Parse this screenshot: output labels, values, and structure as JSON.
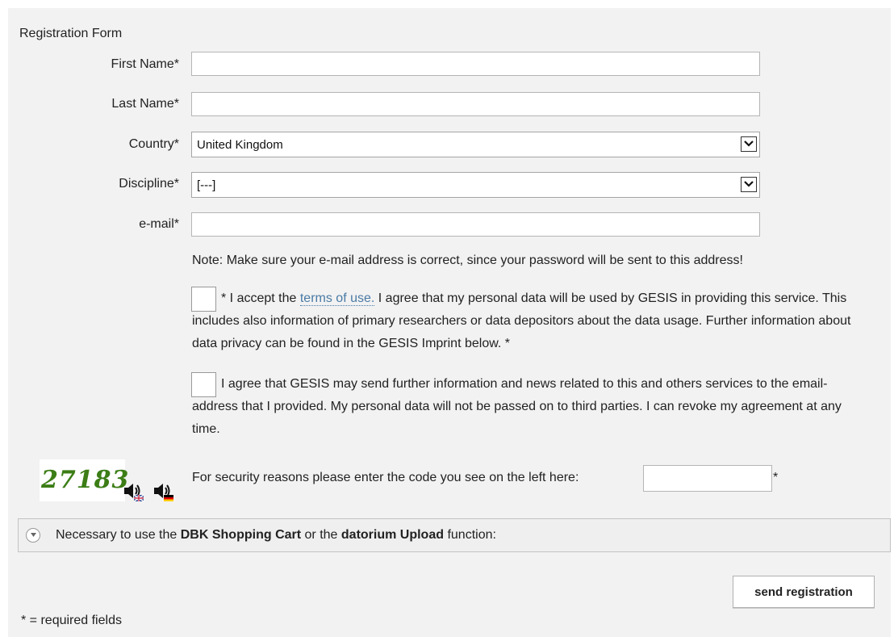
{
  "form": {
    "title": "Registration Form",
    "fields": {
      "first_name": {
        "label": "First Name*",
        "value": ""
      },
      "last_name": {
        "label": "Last Name*",
        "value": ""
      },
      "country": {
        "label": "Country*",
        "selected": "United Kingdom"
      },
      "discipline": {
        "label": "Discipline*",
        "selected": "[---]"
      },
      "email": {
        "label": "e-mail*",
        "value": ""
      }
    },
    "note": "Note: Make sure your e-mail address is correct, since your password will be sent to this address!",
    "terms": {
      "prefix": "* I accept the ",
      "link": "terms of use.",
      "rest": " I agree that my personal data will be used by GESIS in providing this service. This includes also information of primary researchers or data depositors about the data usage. Further information about data privacy can be found in the GESIS Imprint below. *",
      "checked": false
    },
    "newsletter": {
      "text": "I agree that GESIS may send further information and news related to this and others services to the email-address that I provided. My personal data will not be passed on to third parties. I can revoke my agreement at any time.",
      "checked": false
    },
    "captcha": {
      "code": "27183",
      "label": "For security reasons please enter the code you see on the left here:",
      "required_marker": "*",
      "value": ""
    },
    "section": {
      "prefix": "Necessary to use the ",
      "bold1": "DBK Shopping Cart",
      "middle": " or the ",
      "bold2": "datorium Upload",
      "suffix": " function:"
    },
    "submit_label": "send registration",
    "footnote": "* = required fields"
  },
  "icons": {
    "speaker_en": "speaker-uk-flag-icon",
    "speaker_de": "speaker-de-flag-icon",
    "dropdown": "chevron-down-icon",
    "section_toggle": "expand-toggle-icon"
  },
  "colors": {
    "captcha_text": "#3c7d16",
    "link": "#4a7aa5",
    "panel_bg": "#f2f2f2"
  }
}
